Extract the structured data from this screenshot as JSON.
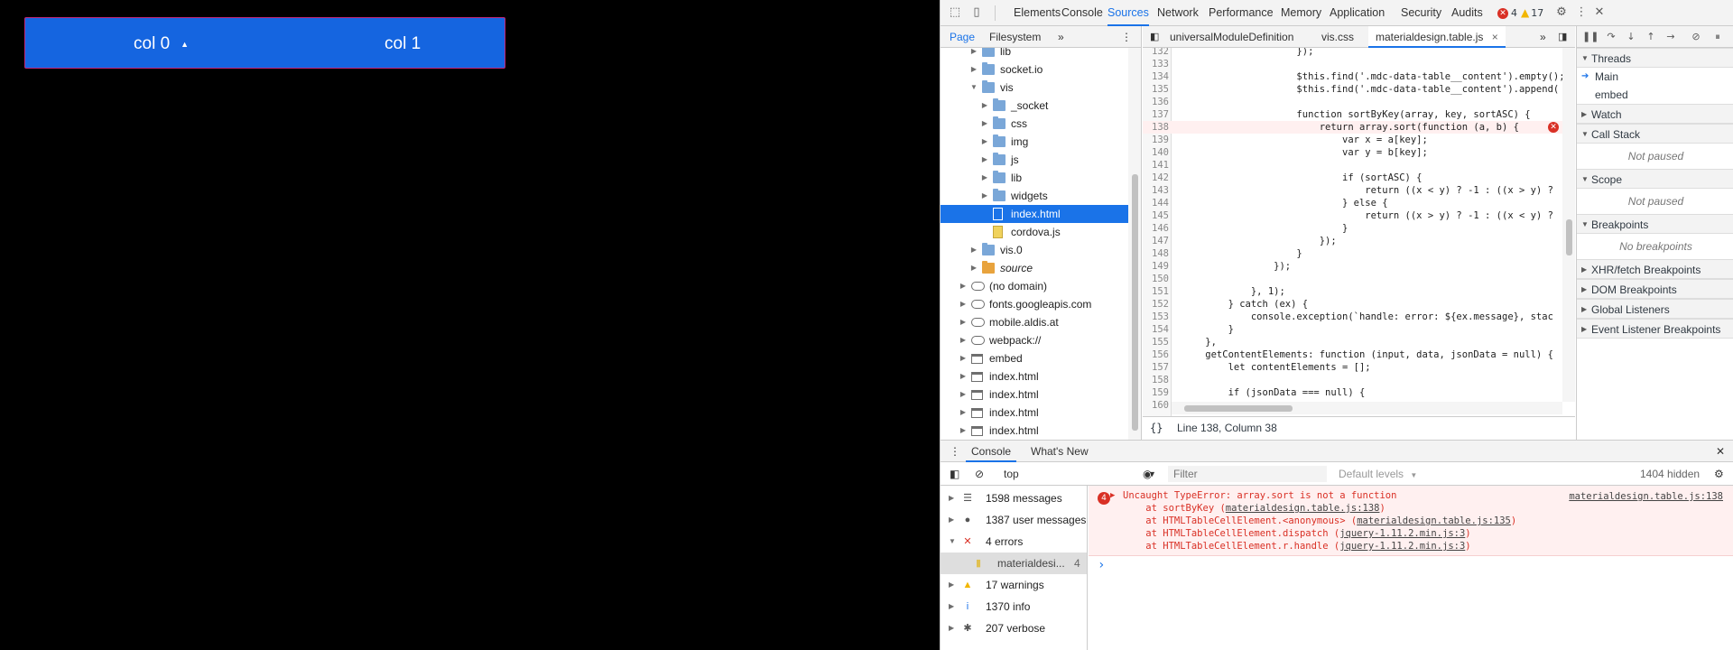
{
  "page": {
    "columns": [
      {
        "label": "col 0",
        "sort_indicator": "▲"
      },
      {
        "label": "col 1"
      }
    ]
  },
  "devtools": {
    "main_tabs": [
      "Elements",
      "Console",
      "Sources",
      "Network",
      "Performance",
      "Memory",
      "Application",
      "Security",
      "Audits"
    ],
    "active_tab": "Sources",
    "error_count": "4",
    "warning_count": "17",
    "navigator": {
      "tabs": [
        "Page",
        "Filesystem"
      ],
      "more": "»",
      "tree": [
        {
          "label": "lib",
          "icon": "folder",
          "depth": 2,
          "state": "collapsed"
        },
        {
          "label": "socket.io",
          "icon": "folder",
          "depth": 2,
          "state": "collapsed"
        },
        {
          "label": "vis",
          "icon": "folder",
          "depth": 2,
          "state": "expanded"
        },
        {
          "label": "_socket",
          "icon": "folder",
          "depth": 3,
          "state": "collapsed"
        },
        {
          "label": "css",
          "icon": "folder",
          "depth": 3,
          "state": "collapsed"
        },
        {
          "label": "img",
          "icon": "folder",
          "depth": 3,
          "state": "collapsed"
        },
        {
          "label": "js",
          "icon": "folder",
          "depth": 3,
          "state": "collapsed"
        },
        {
          "label": "lib",
          "icon": "folder",
          "depth": 3,
          "state": "collapsed"
        },
        {
          "label": "widgets",
          "icon": "folder",
          "depth": 3,
          "state": "collapsed"
        },
        {
          "label": "index.html",
          "icon": "file",
          "depth": 3,
          "state": "none",
          "selected": true
        },
        {
          "label": "cordova.js",
          "icon": "js",
          "depth": 3,
          "state": "none"
        },
        {
          "label": "vis.0",
          "icon": "folder",
          "depth": 2,
          "state": "collapsed"
        },
        {
          "label": "source",
          "icon": "folder-orange",
          "depth": 2,
          "state": "collapsed",
          "italic": true
        },
        {
          "label": "(no domain)",
          "icon": "cloud",
          "depth": 1,
          "state": "collapsed"
        },
        {
          "label": "fonts.googleapis.com",
          "icon": "cloud",
          "depth": 1,
          "state": "collapsed"
        },
        {
          "label": "mobile.aldis.at",
          "icon": "cloud",
          "depth": 1,
          "state": "collapsed"
        },
        {
          "label": "webpack://",
          "icon": "cloud",
          "depth": 1,
          "state": "collapsed"
        },
        {
          "label": "embed",
          "icon": "frame",
          "depth": 1,
          "state": "collapsed"
        },
        {
          "label": "index.html",
          "icon": "frame",
          "depth": 1,
          "state": "collapsed"
        },
        {
          "label": "index.html",
          "icon": "frame",
          "depth": 1,
          "state": "collapsed"
        },
        {
          "label": "index.html",
          "icon": "frame",
          "depth": 1,
          "state": "collapsed"
        },
        {
          "label": "index.html",
          "icon": "frame",
          "depth": 1,
          "state": "collapsed"
        }
      ]
    },
    "editor": {
      "tabs": [
        "universalModuleDefinition",
        "vis.css",
        "materialdesign.table.js"
      ],
      "active_file": "materialdesign.table.js",
      "more": "»",
      "lines": [
        {
          "n": "132",
          "code": "                    });"
        },
        {
          "n": "133",
          "code": ""
        },
        {
          "n": "134",
          "code": "                    $this.find('.mdc-data-table__content').empty();"
        },
        {
          "n": "135",
          "code": "                    $this.find('.mdc-data-table__content').append("
        },
        {
          "n": "136",
          "code": ""
        },
        {
          "n": "137",
          "code": "                    function sortByKey(array, key, sortASC) {"
        },
        {
          "n": "138",
          "code": "                        return array.sort(function (a, b) {",
          "error": true
        },
        {
          "n": "139",
          "code": "                            var x = a[key];"
        },
        {
          "n": "140",
          "code": "                            var y = b[key];"
        },
        {
          "n": "141",
          "code": ""
        },
        {
          "n": "142",
          "code": "                            if (sortASC) {"
        },
        {
          "n": "143",
          "code": "                                return ((x < y) ? -1 : ((x > y) ?"
        },
        {
          "n": "144",
          "code": "                            } else {"
        },
        {
          "n": "145",
          "code": "                                return ((x > y) ? -1 : ((x < y) ?"
        },
        {
          "n": "146",
          "code": "                            }"
        },
        {
          "n": "147",
          "code": "                        });"
        },
        {
          "n": "148",
          "code": "                    }"
        },
        {
          "n": "149",
          "code": "                });"
        },
        {
          "n": "150",
          "code": ""
        },
        {
          "n": "151",
          "code": "            }, 1);"
        },
        {
          "n": "152",
          "code": "        } catch (ex) {"
        },
        {
          "n": "153",
          "code": "            console.exception(`handle: error: ${ex.message}, stac"
        },
        {
          "n": "154",
          "code": "        }"
        },
        {
          "n": "155",
          "code": "    },"
        },
        {
          "n": "156",
          "code": "    getContentElements: function (input, data, jsonData = null) {"
        },
        {
          "n": "157",
          "code": "        let contentElements = [];"
        },
        {
          "n": "158",
          "code": ""
        },
        {
          "n": "159",
          "code": "        if (jsonData === null) {"
        },
        {
          "n": "160",
          "code": ""
        }
      ],
      "status": "Line 138, Column 38",
      "format_button": "{}"
    },
    "debugger": {
      "sections": [
        {
          "title": "Threads",
          "expanded": true
        },
        {
          "title": "Watch",
          "expanded": false
        },
        {
          "title": "Call Stack",
          "expanded": true,
          "empty_text": "Not paused"
        },
        {
          "title": "Scope",
          "expanded": true,
          "empty_text": "Not paused"
        },
        {
          "title": "Breakpoints",
          "expanded": true,
          "empty_text": "No breakpoints"
        },
        {
          "title": "XHR/fetch Breakpoints",
          "expanded": false
        },
        {
          "title": "DOM Breakpoints",
          "expanded": false
        },
        {
          "title": "Global Listeners",
          "expanded": false
        },
        {
          "title": "Event Listener Breakpoints",
          "expanded": false
        }
      ],
      "threads": [
        "Main",
        "embed"
      ]
    },
    "drawer": {
      "tabs": [
        "Console",
        "What's New"
      ],
      "context": "top",
      "filter_placeholder": "Filter",
      "levels": "Default levels",
      "hidden": "1404 hidden",
      "sidebar": [
        {
          "label": "1598 messages",
          "icon": "list",
          "count": ""
        },
        {
          "label": "1387 user messages",
          "icon": "user",
          "count": ""
        },
        {
          "label": "4 errors",
          "icon": "error",
          "count": "",
          "expanded": true
        },
        {
          "label": "materialdesi...",
          "icon": "js-file",
          "count": "4",
          "child": true
        },
        {
          "label": "17 warnings",
          "icon": "warning",
          "count": ""
        },
        {
          "label": "1370 info",
          "icon": "info",
          "count": ""
        },
        {
          "label": "207 verbose",
          "icon": "verbose",
          "count": ""
        }
      ],
      "error": {
        "count": "4",
        "message": "Uncaught TypeError: array.sort is not a function",
        "location": "materialdesign.table.js:138",
        "stack": [
          {
            "prefix": "    at sortByKey (",
            "link": "materialdesign.table.js:138",
            "suffix": ")"
          },
          {
            "prefix": "    at HTMLTableCellElement.<anonymous> (",
            "link": "materialdesign.table.js:135",
            "suffix": ")"
          },
          {
            "prefix": "    at HTMLTableCellElement.dispatch (",
            "link": "jquery-1.11.2.min.js:3",
            "suffix": ")"
          },
          {
            "prefix": "    at HTMLTableCellElement.r.handle (",
            "link": "jquery-1.11.2.min.js:3",
            "suffix": ")"
          }
        ]
      },
      "prompt": "›"
    }
  }
}
